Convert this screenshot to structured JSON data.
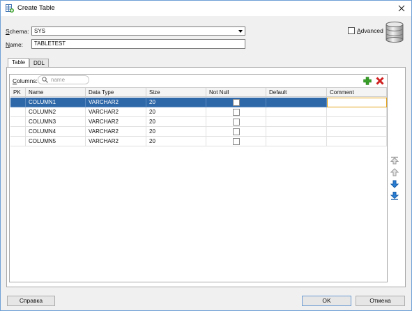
{
  "window": {
    "title": "Create Table"
  },
  "form": {
    "schema_label_underlined": "S",
    "schema_label_rest": "chema:",
    "schema_value": "SYS",
    "name_label_underlined": "N",
    "name_label_rest": "ame:",
    "name_value": "TABLETEST",
    "advanced_label_underlined": "A",
    "advanced_label_rest": "dvanced",
    "advanced_checked": false
  },
  "tabs": [
    {
      "label": "Table",
      "active": true
    },
    {
      "label": "DDL",
      "active": false
    }
  ],
  "columns_panel": {
    "label_underlined": "C",
    "label_rest": "olumns:",
    "search_placeholder": "name",
    "headers": [
      "PK",
      "Name",
      "Data Type",
      "Size",
      "Not Null",
      "Default",
      "Comment"
    ],
    "rows": [
      {
        "pk": "",
        "name": "COLUMN1",
        "type": "VARCHAR2",
        "size": "20",
        "not_null": false,
        "default": "",
        "comment": "",
        "selected": true
      },
      {
        "pk": "",
        "name": "COLUMN2",
        "type": "VARCHAR2",
        "size": "20",
        "not_null": false,
        "default": "",
        "comment": "",
        "selected": false
      },
      {
        "pk": "",
        "name": "COLUMN3",
        "type": "VARCHAR2",
        "size": "20",
        "not_null": false,
        "default": "",
        "comment": "",
        "selected": false
      },
      {
        "pk": "",
        "name": "COLUMN4",
        "type": "VARCHAR2",
        "size": "20",
        "not_null": false,
        "default": "",
        "comment": "",
        "selected": false
      },
      {
        "pk": "",
        "name": "COLUMN5",
        "type": "VARCHAR2",
        "size": "20",
        "not_null": false,
        "default": "",
        "comment": "",
        "selected": false
      }
    ]
  },
  "buttons": {
    "help": "Справка",
    "ok": "OK",
    "cancel": "Отмена"
  },
  "icons": {
    "app": "create-table-icon",
    "close": "close-icon",
    "database": "database-icon",
    "search": "search-icon",
    "add": "add-icon",
    "delete": "delete-icon",
    "move_top": "move-top-icon",
    "move_up": "move-up-icon",
    "move_down": "move-down-icon",
    "move_bottom": "move-bottom-icon"
  },
  "colors": {
    "selection": "#2f68a8",
    "add_green": "#3aa02a",
    "delete_red": "#d02020",
    "edit_outline": "#e2a21a",
    "move_blue": "#2a7fd4"
  }
}
